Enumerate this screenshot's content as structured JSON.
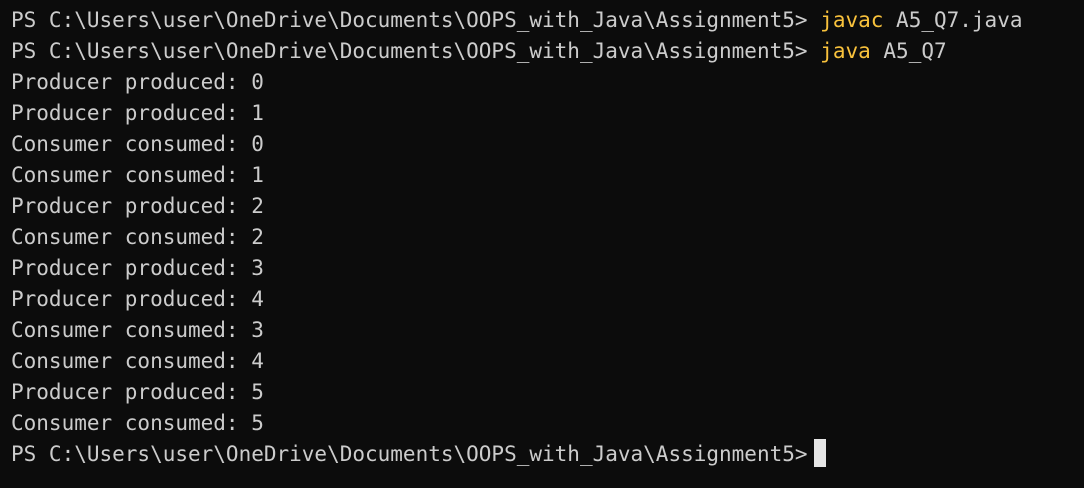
{
  "terminal": {
    "prompt": "PS C:\\Users\\user\\OneDrive\\Documents\\OOPS_with_Java\\Assignment5>",
    "commands": [
      {
        "cmd": "javac",
        "args": "A5_Q7.java"
      },
      {
        "cmd": "java",
        "args": "A5_Q7"
      }
    ],
    "output": [
      "Producer produced: 0",
      "Producer produced: 1",
      "Consumer consumed: 0",
      "Consumer consumed: 1",
      "Producer produced: 2",
      "Consumer consumed: 2",
      "Producer produced: 3",
      "Producer produced: 4",
      "Consumer consumed: 3",
      "Consumer consumed: 4",
      "Producer produced: 5",
      "Consumer consumed: 5"
    ],
    "colors": {
      "background": "#0c0c0c",
      "text": "#cccccc",
      "command": "#f9c23c",
      "cursor": "#e6e6e6"
    }
  }
}
